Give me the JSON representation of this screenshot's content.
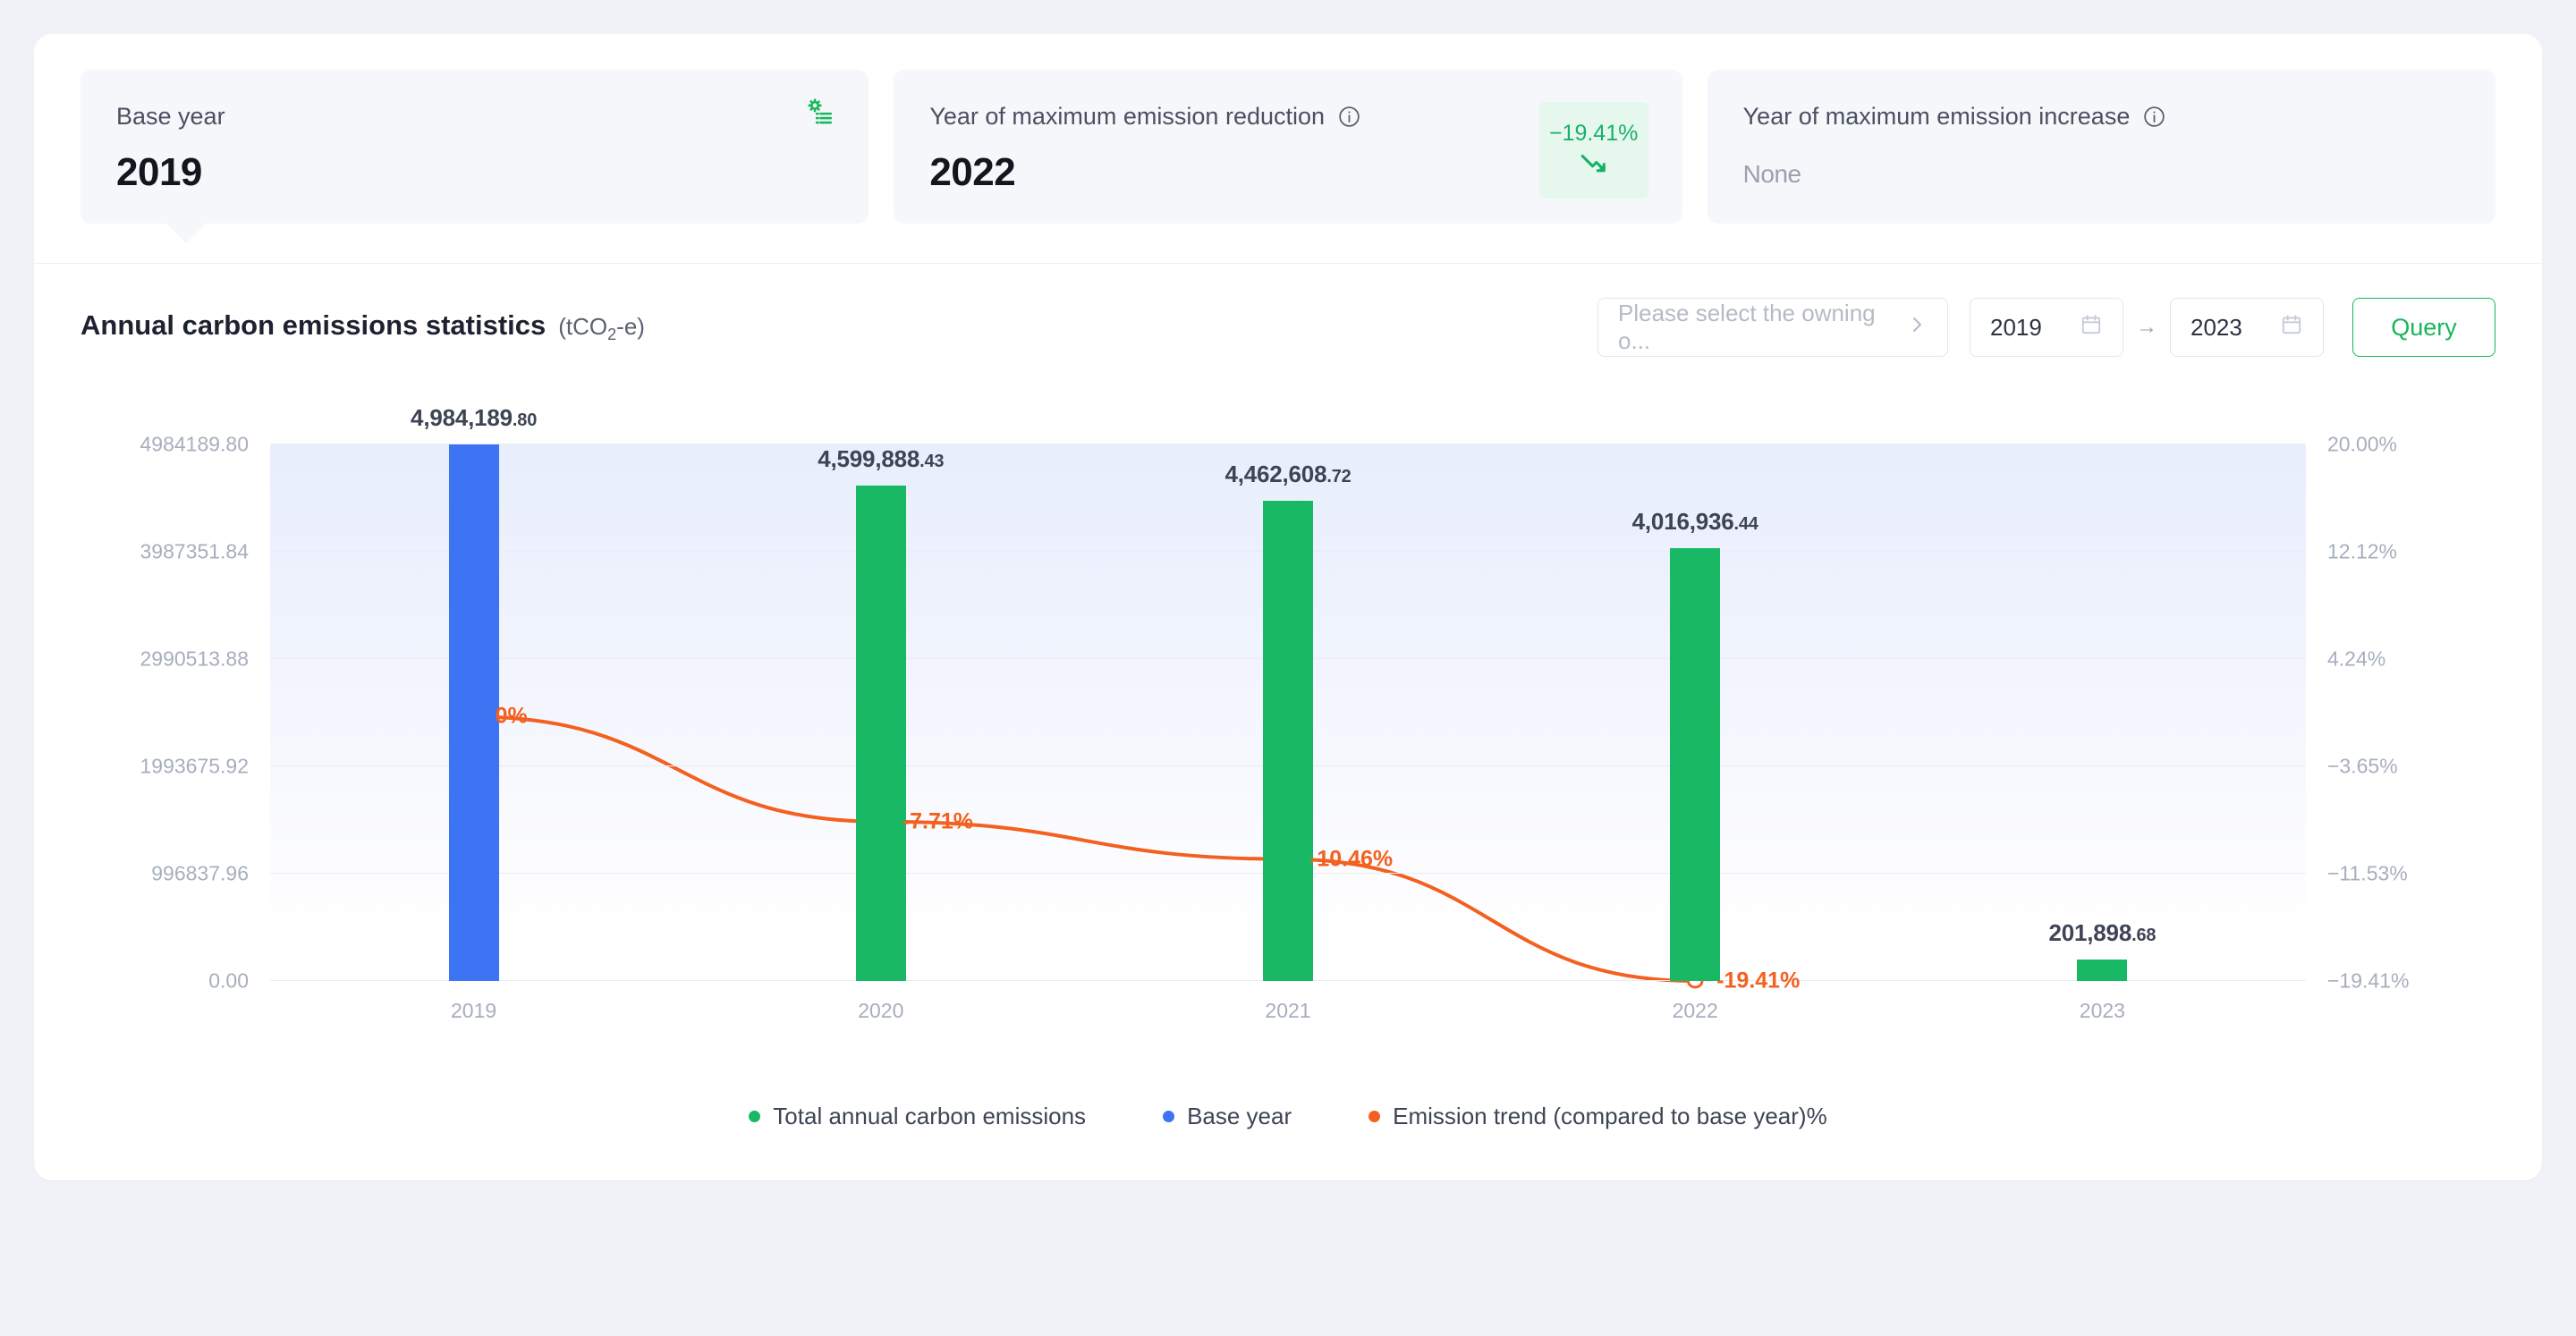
{
  "kpi": {
    "cards": [
      {
        "label": "Base year",
        "value": "2019",
        "icon": "settings-list-icon"
      },
      {
        "label": "Year of maximum emission reduction",
        "value": "2022",
        "badge": "−19.41%",
        "icon": "info-icon"
      },
      {
        "label": "Year of maximum emission increase",
        "value": "None",
        "icon": "info-icon"
      }
    ]
  },
  "chart_header": {
    "title": "Annual carbon emissions statistics",
    "unit_prefix": "(tCO",
    "unit_sub": "2",
    "unit_suffix": "-e)",
    "org_placeholder": "Please select the owning o...",
    "date_from": "2019",
    "date_to": "2023",
    "range_separator": "→",
    "query_label": "Query"
  },
  "colors": {
    "green": "#18b864",
    "blue": "#3d74f4",
    "orange": "#f4601f",
    "badge_bg": "#e6f8ee",
    "badge_text": "#17b26a"
  },
  "legend": [
    {
      "label": "Total annual carbon emissions",
      "color": "#18b864"
    },
    {
      "label": "Base year",
      "color": "#3d74f4"
    },
    {
      "label": "Emission trend (compared to base year)%",
      "color": "#f4601f"
    }
  ],
  "chart_data": {
    "type": "bar",
    "title": "Annual carbon emissions statistics (tCO2-e)",
    "xlabel": "",
    "ylabel": "",
    "grid": true,
    "legend_position": "bottom",
    "categories": [
      "2019",
      "2020",
      "2021",
      "2022",
      "2023"
    ],
    "y_left_ticks": [
      "0.00",
      "996837.96",
      "1993675.92",
      "2990513.88",
      "3987351.84",
      "4984189.80"
    ],
    "y_right_ticks": [
      "−19.41%",
      "−11.53%",
      "−3.65%",
      "4.24%",
      "12.12%",
      "20.00%"
    ],
    "ylim": [
      0,
      4984189.8
    ],
    "ylim_right": [
      -19.41,
      20.0
    ],
    "series": [
      {
        "name": "Total annual carbon emissions",
        "type": "bar",
        "color": "#18b864",
        "values": [
          4984189.8,
          4599888.43,
          4462608.72,
          4016936.44,
          201898.68
        ],
        "labels": [
          "4,984,189.80",
          "4,599,888.43",
          "4,462,608.72",
          "4,016,936.44",
          "201,898.68"
        ],
        "bar_colors": [
          "#3d74f4",
          "#18b864",
          "#18b864",
          "#18b864",
          "#18b864"
        ]
      },
      {
        "name": "Emission trend (compared to base year)%",
        "type": "line",
        "color": "#f4601f",
        "axis": "right",
        "x": [
          "2019",
          "2020",
          "2021",
          "2022"
        ],
        "values": [
          0,
          -7.71,
          -10.46,
          -19.41
        ],
        "labels": [
          "0%",
          "-7.71%",
          "-10.46%",
          "-19.41%"
        ]
      }
    ]
  }
}
